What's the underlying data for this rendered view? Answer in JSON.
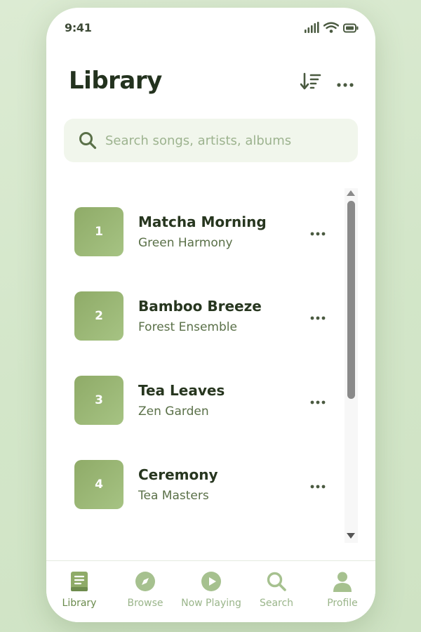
{
  "status_bar": {
    "time": "9:41"
  },
  "header": {
    "title": "Library"
  },
  "search": {
    "placeholder": "Search songs, artists, albums",
    "value": ""
  },
  "songs": [
    {
      "number": "1",
      "title": "Matcha Morning",
      "artist": "Green Harmony"
    },
    {
      "number": "2",
      "title": "Bamboo Breeze",
      "artist": "Forest Ensemble"
    },
    {
      "number": "3",
      "title": "Tea Leaves",
      "artist": "Zen Garden"
    },
    {
      "number": "4",
      "title": "Ceremony",
      "artist": "Tea Masters"
    },
    {
      "number": "",
      "title": "",
      "artist": ""
    }
  ],
  "tabs": [
    {
      "label": "Library",
      "icon": "book-icon",
      "active": true
    },
    {
      "label": "Browse",
      "icon": "compass-icon",
      "active": false
    },
    {
      "label": "Now Playing",
      "icon": "play-circle-icon",
      "active": false
    },
    {
      "label": "Search",
      "icon": "search-icon",
      "active": false
    },
    {
      "label": "Profile",
      "icon": "person-icon",
      "active": false
    }
  ],
  "colors": {
    "accent": "#8fab68",
    "accent_light": "#a6c383",
    "title_text": "#23321e",
    "secondary_text": "#5a7048",
    "tab_inactive": "#9ab58a",
    "search_bg": "#f1f6ec",
    "page_bg": "#d3e6c9"
  }
}
